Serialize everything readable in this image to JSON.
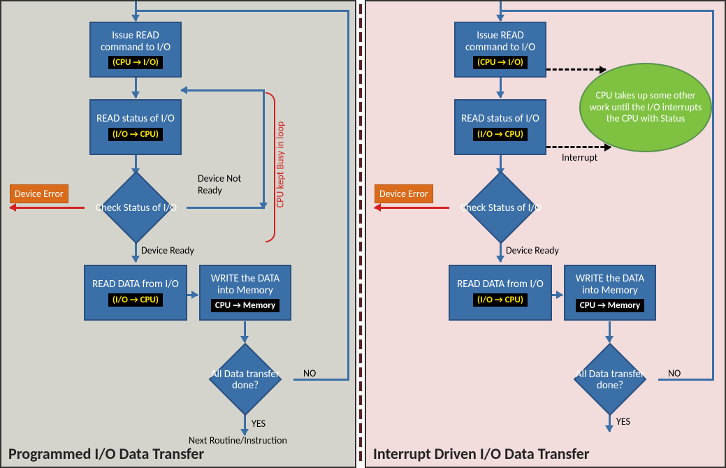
{
  "left": {
    "title": "Programmed I/O Data Transfer",
    "box_issue": "Issue READ command to I/O",
    "tag_issue": "(CPU → I/O)",
    "box_readstatus": "READ status of I/O",
    "tag_readstatus": "(I/O → CPU)",
    "diamond_check": "Check Status of I/O",
    "label_notready": "Device Not Ready",
    "label_ready": "Device Ready",
    "err": "Device Error",
    "box_readdata": "READ DATA from I/O",
    "tag_readdata": "(I/O → CPU)",
    "box_write": "WRITE the DATA into Memory",
    "tag_write": "CPU → Memory",
    "diamond_done": "All  Data transfer done?",
    "label_no": "NO",
    "label_yes": "YES",
    "label_next": "Next Routine/Instruction",
    "brace": "CPU kept Busy in loop"
  },
  "right": {
    "title": "Interrupt Driven I/O Data Transfer",
    "box_issue": "Issue READ command to I/O",
    "tag_issue": "(CPU → I/O)",
    "box_readstatus": "READ status of I/O",
    "tag_readstatus": "(I/O → CPU)",
    "diamond_check": "Check Status of I/O",
    "label_ready": "Device Ready",
    "err": "Device Error",
    "box_readdata": "READ DATA from I/O",
    "tag_readdata": "(I/O → CPU)",
    "box_write": "WRITE the DATA into Memory",
    "tag_write": "CPU → Memory",
    "diamond_done": "All  Data transfer done?",
    "label_no": "NO",
    "label_yes": "YES",
    "label_interrupt": "Interrupt",
    "ellipse": "CPU takes up some other work until the I/O interrupts the CPU with Status"
  }
}
